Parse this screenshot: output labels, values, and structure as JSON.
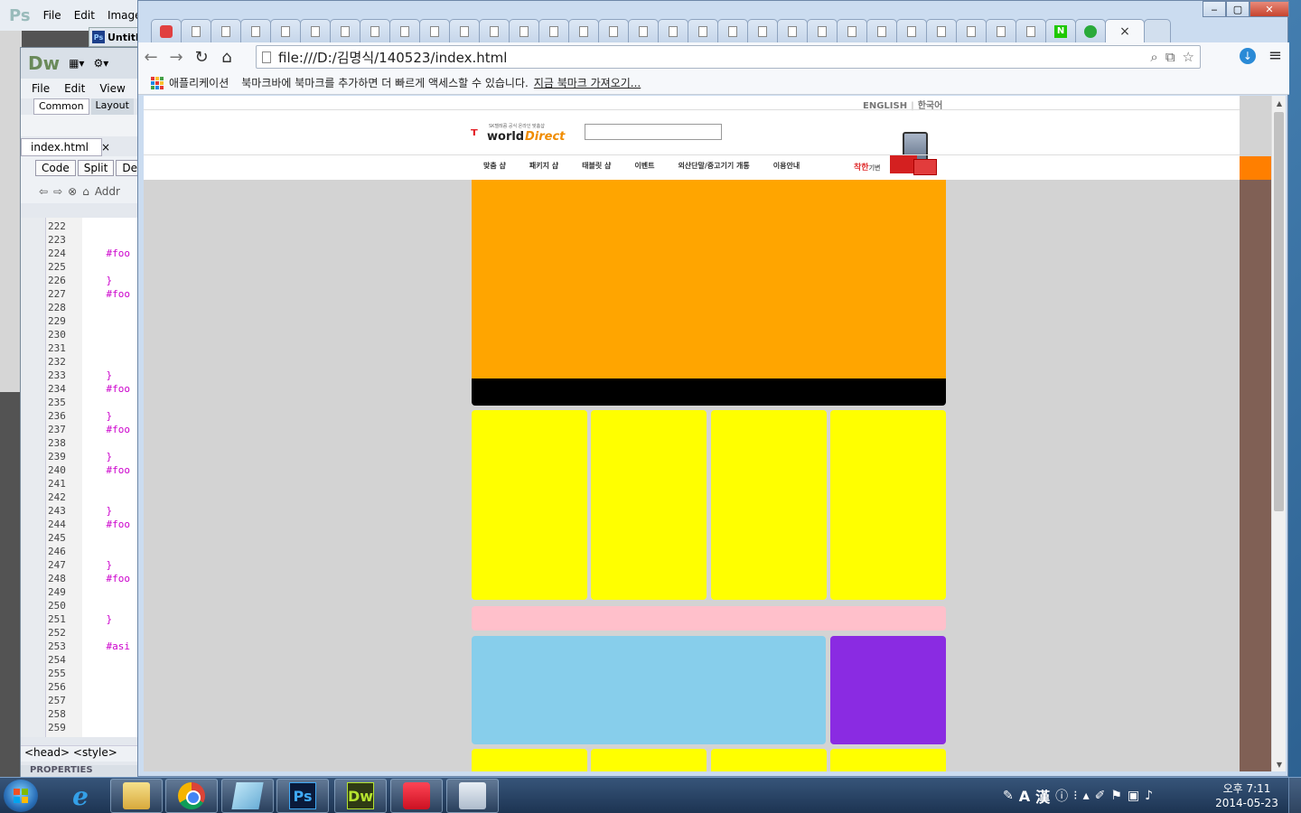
{
  "photoshop": {
    "logo": "Ps",
    "menu": [
      "File",
      "Edit",
      "Image"
    ],
    "doc_tab": "Untitl"
  },
  "dreamweaver": {
    "logo": "Dw",
    "menu": [
      "File",
      "Edit",
      "View"
    ],
    "insert_tabs": [
      "Common",
      "Layout"
    ],
    "doc_tab": "index.html",
    "doc_tab_close": "×",
    "view_buttons": [
      "Code",
      "Split",
      "De"
    ],
    "address_label": "Addr",
    "line_numbers": [
      "222",
      "223",
      "224",
      "225",
      "226",
      "227",
      "228",
      "229",
      "230",
      "231",
      "232",
      "233",
      "234",
      "235",
      "236",
      "237",
      "238",
      "239",
      "240",
      "241",
      "242",
      "243",
      "244",
      "245",
      "246",
      "247",
      "248",
      "249",
      "250",
      "251",
      "252",
      "253",
      "254",
      "255",
      "256",
      "257",
      "258",
      "259"
    ],
    "code_lines": [
      "",
      "",
      "    #foo",
      "",
      "    }",
      "    #foo",
      "",
      "",
      "",
      "",
      "",
      "    }",
      "    #foo",
      "",
      "    }",
      "    #foo",
      "",
      "    }",
      "    #foo",
      "",
      "",
      "    }",
      "    #foo",
      "",
      "",
      "    }",
      "    #foo",
      "",
      "",
      "    }",
      "",
      "    #asi",
      "",
      "",
      "",
      "",
      "",
      ""
    ],
    "status_tags": [
      "<head>",
      "<style>"
    ],
    "properties_label": "PROPERTIES"
  },
  "chrome": {
    "url": "file:///D:/김명식/140523/index.html",
    "active_tab_close": "×",
    "window_buttons": {
      "minimize": "‒",
      "maximize": "▢",
      "close": "✕"
    },
    "bookmarks_bar": {
      "apps_label": "애플리케이션",
      "message": "북마크바에 북마크를 추가하면 더 빠르게 액세스할 수 있습니다.",
      "import_link": "지금 북마크 가져오기..."
    }
  },
  "site": {
    "lang_english": "ENGLISH",
    "lang_korean": "한국어",
    "lang_sep": "|",
    "logo_tagline": "SK텔레콤 공식 온라인 맞춤샵",
    "logo_world": "world",
    "logo_direct": "Direct",
    "nav": [
      "맞춤 샵",
      "패키지 샵",
      "태블릿 샵",
      "이벤트",
      "외산단말/중고기기 개통",
      "이용안내"
    ],
    "event_text": "착한",
    "event_subtext": "기변",
    "colors": {
      "orange": "#ffa500",
      "black": "#000000",
      "yellow": "#ffff00",
      "pink": "#ffc0cb",
      "skyblue": "#87ceeb",
      "purple": "#8a2be2",
      "side_orange": "#ff7f00",
      "side_brown": "#806055",
      "background": "#d3d3d3"
    }
  },
  "taskbar": {
    "apps": [
      "start-button",
      "internet-explorer",
      "file-explorer",
      "chrome",
      "word",
      "photoshop",
      "dreamweaver",
      "paint",
      "calculator"
    ],
    "ime_a": "A",
    "ime_han": "漢",
    "clock_time": "오후 7:11",
    "clock_date": "2014-05-23"
  }
}
